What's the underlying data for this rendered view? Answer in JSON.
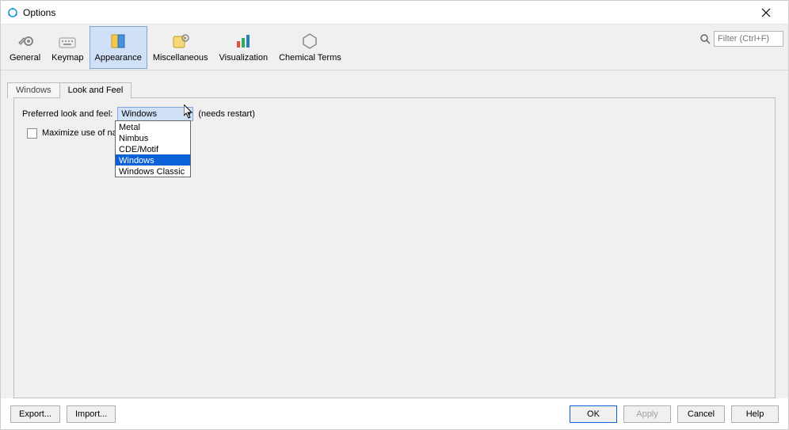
{
  "window": {
    "title": "Options"
  },
  "filter": {
    "placeholder": "Filter (Ctrl+F)"
  },
  "categories": [
    {
      "id": "general",
      "label": "General"
    },
    {
      "id": "keymap",
      "label": "Keymap"
    },
    {
      "id": "appearance",
      "label": "Appearance",
      "selected": true
    },
    {
      "id": "misc",
      "label": "Miscellaneous"
    },
    {
      "id": "visualization",
      "label": "Visualization"
    },
    {
      "id": "chemterms",
      "label": "Chemical Terms"
    }
  ],
  "tabs": [
    {
      "id": "tab-windows",
      "label": "Windows"
    },
    {
      "id": "tab-laf",
      "label": "Look and Feel",
      "active": true
    }
  ],
  "form": {
    "lookfeel_label": "Preferred look and feel:",
    "lookfeel_value": "Windows",
    "lookfeel_hint": "(needs restart)",
    "maximize_label": "Maximize use of nat",
    "maximize_checked": false,
    "lookfeel_options": [
      "Metal",
      "Nimbus",
      "CDE/Motif",
      "Windows",
      "Windows Classic"
    ],
    "lookfeel_selected_index": 3
  },
  "buttons": {
    "export": "Export...",
    "import": "Import...",
    "ok": "OK",
    "apply": "Apply",
    "cancel": "Cancel",
    "help": "Help"
  }
}
